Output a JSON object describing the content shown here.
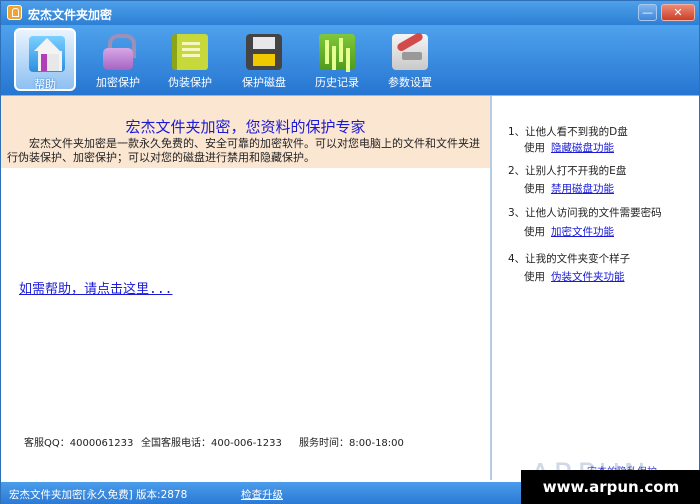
{
  "window": {
    "title": "宏杰文件夹加密",
    "minimize_glyph": "—",
    "close_glyph": "✕"
  },
  "toolbar": {
    "items": [
      {
        "label": "帮助",
        "icon": "home-icon",
        "active": true
      },
      {
        "label": "加密保护",
        "icon": "lock-icon",
        "active": false
      },
      {
        "label": "伪装保护",
        "icon": "book-icon",
        "active": false
      },
      {
        "label": "保护磁盘",
        "icon": "disk-icon",
        "active": false
      },
      {
        "label": "历史记录",
        "icon": "history-icon",
        "active": false
      },
      {
        "label": "参数设置",
        "icon": "settings-icon",
        "active": false
      }
    ]
  },
  "intro": {
    "title": "宏杰文件夹加密，您资料的保护专家",
    "text": "宏杰文件夹加密是一款永久免费的、安全可靠的加密软件。可以对您电脑上的文件和文件夹进行伪装保护、加密保护；可以对您的磁盘进行禁用和隐藏保护。"
  },
  "help_link": "如需帮助，请点击这里...",
  "contact": {
    "qq": "客服QQ：4000061233",
    "phone": "全国客服电话：400-006-1233",
    "hours": "服务时间：8:00-18:00"
  },
  "right_panel": {
    "items": [
      {
        "title": "1、让他人看不到我的D盘",
        "use": "使用",
        "link": "隐藏磁盘功能"
      },
      {
        "title": "2、让别人打不开我的E盘",
        "use": "使用",
        "link": "禁用磁盘功能"
      },
      {
        "title": "3、让他人访问我的文件需要密码",
        "use": "使用",
        "link": "加密文件功能"
      },
      {
        "title": "4、让我的文件夹变个样子",
        "use": "使用",
        "link": "伪装文件夹功能"
      }
    ],
    "promo_link": "宏杰的隐私保护"
  },
  "watermark": "ARPUN",
  "site_banner": "www.arpun.com",
  "statusbar": {
    "version_text": "宏杰文件夹加密[永久免费] 版本:2878",
    "update_link": "检查升级"
  },
  "colors": {
    "titlebar": "#2d7fd6",
    "link": "#1a1ad8",
    "intro_bg": "#fbe6d2"
  }
}
